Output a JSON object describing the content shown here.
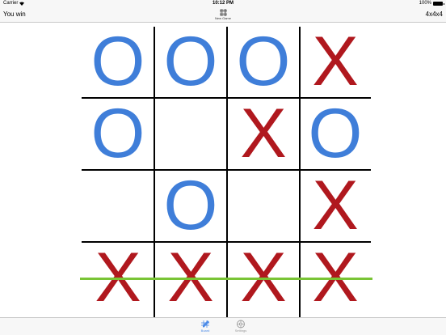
{
  "status_bar": {
    "carrier": "Carrier",
    "time": "10:12 PM",
    "battery": "100%"
  },
  "nav": {
    "status_text": "You win",
    "new_game_label": "New Game",
    "board_size": "4x4x4"
  },
  "board": {
    "rows": [
      [
        "O",
        "O",
        "O",
        "X"
      ],
      [
        "O",
        "",
        "X",
        "O"
      ],
      [
        "",
        "O",
        "",
        "X"
      ],
      [
        "X",
        "X",
        "X",
        "X"
      ]
    ],
    "winning_row": 4,
    "colors": {
      "o": "#3f7ed9",
      "x": "#b0181e",
      "win_line": "#79c435"
    }
  },
  "tabs": [
    {
      "label": "Board",
      "icon": "board-pencil-icon",
      "active": true
    },
    {
      "label": "Settings",
      "icon": "settings-gear-icon",
      "active": false
    }
  ]
}
